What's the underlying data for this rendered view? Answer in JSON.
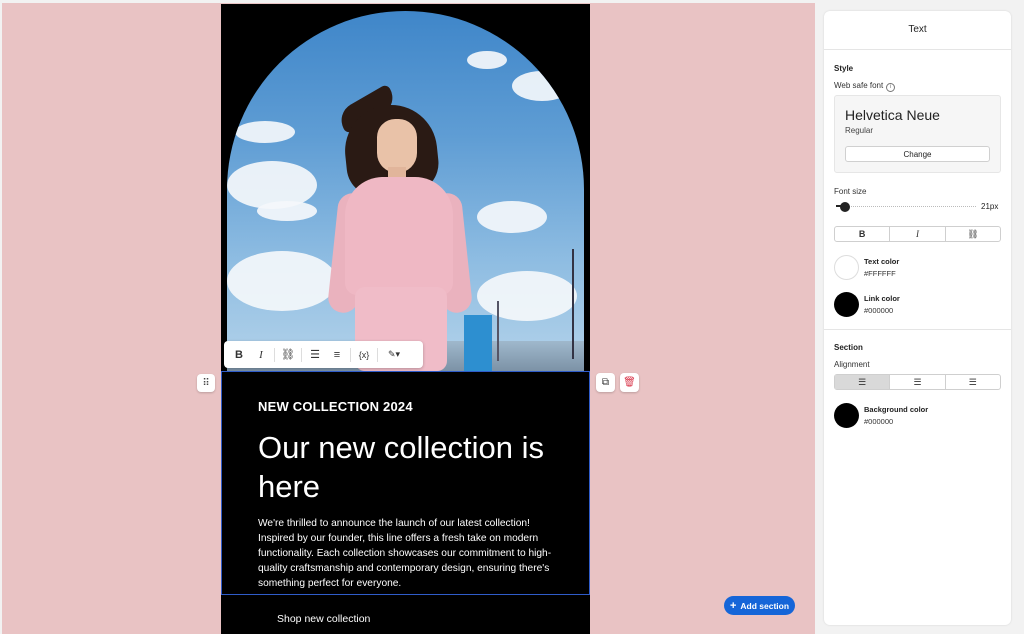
{
  "canvas": {
    "eyebrow": "NEW COLLECTION 2024",
    "headline": "Our new collection is here",
    "body": "We're thrilled to announce the launch of our latest collection! Inspired by our founder, this line offers a fresh take on modern functionality. Each collection showcases our commitment to high-quality craftsmanship and contemporary design, ensuring there's something perfect for everyone.",
    "shop_link": "Shop new collection",
    "add_section": "Add section",
    "add_icon": "+",
    "toolbar": {
      "bold": "B",
      "italic": "I",
      "link": "⛓",
      "bullets": "☰",
      "numbered": "≡",
      "variable": "{x}",
      "color": "✎▾"
    },
    "drag_icon": "⠿",
    "duplicate_icon": "⧉",
    "delete_icon": "🗑"
  },
  "panel": {
    "title": "Text",
    "style_heading": "Style",
    "font_label": "Web safe font",
    "info_icon": "i",
    "font_name": "Helvetica Neue",
    "font_style": "Regular",
    "change_label": "Change",
    "font_size_label": "Font size",
    "font_size_value": "21px",
    "format_buttons": [
      "B",
      "I",
      "⛓"
    ],
    "text_color_label": "Text color",
    "text_color_hex": "#FFFFFF",
    "link_color_label": "Link color",
    "link_color_hex": "#000000",
    "section_heading": "Section",
    "alignment_label": "Alignment",
    "align_buttons": [
      "☰",
      "☰",
      "☰"
    ],
    "bg_color_label": "Background color",
    "bg_color_hex": "#000000"
  },
  "colors": {
    "canvas_bg": "#e9c3c4",
    "accent": "#1565d8",
    "selection": "#2f5cc9",
    "delete": "#d9364a"
  }
}
